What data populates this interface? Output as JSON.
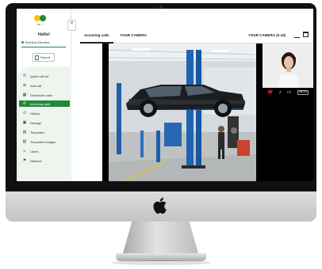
{
  "app": {
    "logo_text": "æ···",
    "greeting": "Hello!",
    "user_name": "Ewelina Sikorska",
    "report_label": "Report",
    "brand_colors": {
      "primary": "#1f8a3a",
      "accent": "#f5c400"
    }
  },
  "sidebar": {
    "items": [
      {
        "label": "Quick call list",
        "icon": "phone-icon"
      },
      {
        "label": "Add call",
        "icon": "add-call-icon"
      },
      {
        "label": "Scheduled calls",
        "icon": "calendar-icon"
      },
      {
        "label": "Incoming calls",
        "icon": "incoming-call-icon",
        "active": true
      },
      {
        "label": "History",
        "icon": "history-icon"
      },
      {
        "label": "Storage",
        "icon": "storage-icon"
      },
      {
        "label": "Templates",
        "icon": "template-icon"
      },
      {
        "label": "Templates images",
        "icon": "images-icon"
      },
      {
        "label": "Users",
        "icon": "users-icon"
      },
      {
        "label": "Network",
        "icon": "network-icon"
      }
    ]
  },
  "main": {
    "tab_incoming": "Incoming calls",
    "camera_left": "YOUR CAMERA",
    "camera_right": "YOUR CAMERA",
    "call_timer": "(0:34)",
    "menu_label": "MENU"
  }
}
